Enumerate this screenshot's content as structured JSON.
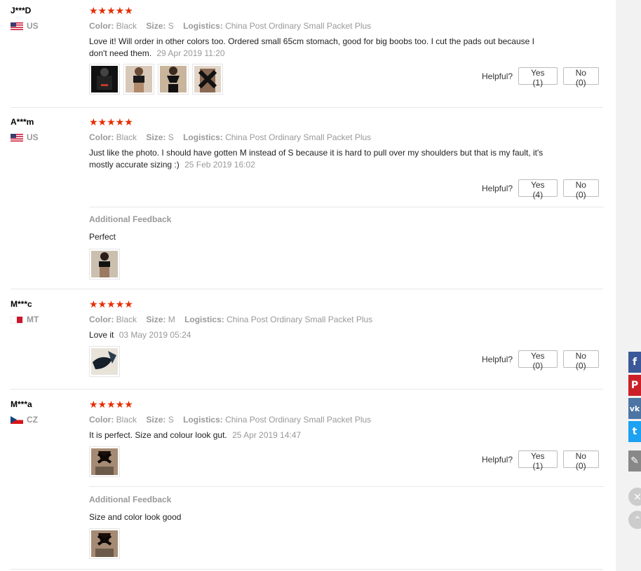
{
  "helpful_label": "Helpful?",
  "additional_feedback_title": "Additional Feedback",
  "stars": "★★★★★",
  "labels": {
    "color": "Color:",
    "size": "Size:",
    "logistics": "Logistics:"
  },
  "reviews": [
    {
      "user": "J***D",
      "country": "US",
      "color": "Black",
      "size": "S",
      "logistics": "China Post Ordinary Small Packet Plus",
      "text": "Love it! Will order in other colors too. Ordered small 65cm stomach, good for big boobs too. I cut the pads out because I don't need them.",
      "date": "29 Apr 2019 11:20",
      "yes": "Yes (1)",
      "no": "No (0)"
    },
    {
      "user": "A***m",
      "country": "US",
      "color": "Black",
      "size": "S",
      "logistics": "China Post Ordinary Small Packet Plus",
      "text": "Just like the photo. I should have gotten M instead of S because it is hard to pull over my shoulders but that is my fault, it's mostly accurate sizing :)",
      "date": "25 Feb 2019 16:02",
      "yes": "Yes (4)",
      "no": "No (0)",
      "additional": "Perfect"
    },
    {
      "user": "M***c",
      "country": "MT",
      "color": "Black",
      "size": "M",
      "logistics": "China Post Ordinary Small Packet Plus",
      "text": "Love it",
      "date": "03 May 2019 05:24",
      "yes": "Yes (0)",
      "no": "No (0)"
    },
    {
      "user": "M***a",
      "country": "CZ",
      "color": "Black",
      "size": "S",
      "logistics": "China Post Ordinary Small Packet Plus",
      "text": "It is perfect. Size and colour look gut.",
      "date": "25 Apr 2019 14:47",
      "yes": "Yes (1)",
      "no": "No (0)",
      "additional": "Size and color look good"
    }
  ],
  "social": {
    "facebook_color": "#3b5998",
    "pinterest_color": "#cb2027",
    "vk_color": "#4c75a3",
    "twitter_color": "#1da1f2",
    "edit_color": "#888888"
  }
}
